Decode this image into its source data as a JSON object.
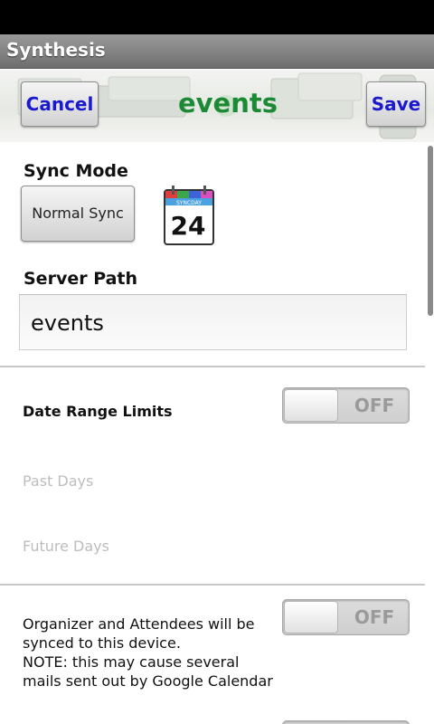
{
  "app": {
    "title": "Synthesis"
  },
  "header": {
    "cancel_label": "Cancel",
    "title": "events",
    "save_label": "Save"
  },
  "sync_mode": {
    "label": "Sync Mode",
    "button_label": "Normal Sync",
    "icon": "calendar-icon",
    "icon_banner": "SYNCDAY",
    "icon_day": "24"
  },
  "server_path": {
    "label": "Server Path",
    "value": "events"
  },
  "date_range": {
    "label": "Date Range Limits",
    "toggle_label": "OFF",
    "past_days_label": "Past Days",
    "future_days_label": "Future Days"
  },
  "attendees": {
    "lines": [
      "Organizer and Attendees will be",
      "synced to this device.",
      "NOTE: this may cause several",
      "mails sent out by Google Calendar"
    ],
    "toggle_label": "OFF"
  },
  "colors": {
    "title_green": "#1c8a35",
    "button_blue": "#1a1acc",
    "disabled_gray": "#bdbdbd"
  }
}
